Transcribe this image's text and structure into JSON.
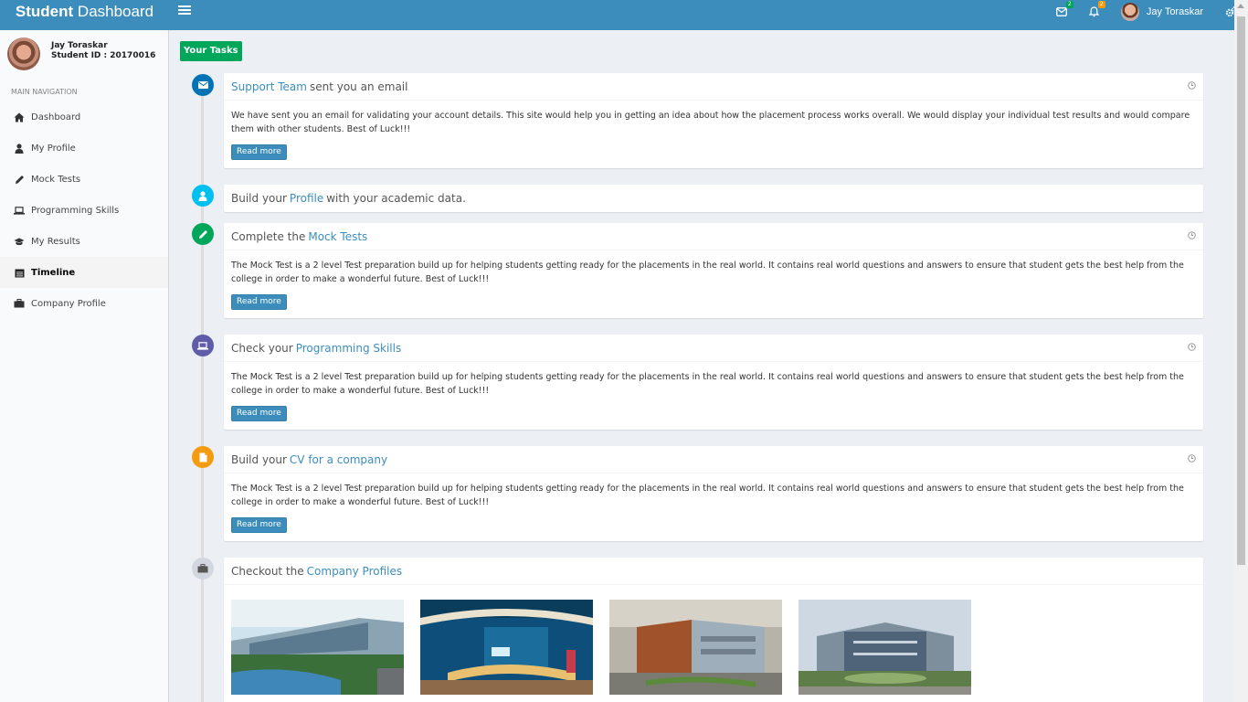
{
  "header": {
    "brand_bold": "Student",
    "brand_rest": " Dashboard",
    "messages_count": "2",
    "notifications_count": "2",
    "user_name": "Jay Toraskar",
    "colors": {
      "primary": "#3c8dbc",
      "badge_green": "#00a65a",
      "badge_yellow": "#f39c12"
    }
  },
  "sidebar": {
    "user_name": "Jay Toraskar",
    "student_id": "Student ID : 20170016",
    "nav_header": "MAIN NAVIGATION",
    "items": [
      {
        "label": "Dashboard",
        "icon": "home-icon"
      },
      {
        "label": "My Profile",
        "icon": "user-icon"
      },
      {
        "label": "Mock Tests",
        "icon": "pencil-icon"
      },
      {
        "label": "Programming Skills",
        "icon": "laptop-icon"
      },
      {
        "label": "My Results",
        "icon": "graduation-cap-icon"
      },
      {
        "label": "Timeline",
        "icon": "calendar-icon",
        "active": true
      },
      {
        "label": "Company Profile",
        "icon": "briefcase-icon"
      }
    ]
  },
  "timeline": {
    "label": "Your Tasks",
    "items": [
      {
        "icon": "envelope-icon",
        "icon_color": "#0073b7",
        "link": "Support Team",
        "after": "sent you an email",
        "body": "We have sent you an email for validating your account details. This site would help you in getting an idea about how the placement process works overall. We would display your individual test results and would compare them with other students. Best of Luck!!!",
        "button": "Read more"
      },
      {
        "icon": "user-icon",
        "icon_color": "#00c0ef",
        "before": "Build your",
        "link": "Profile",
        "after": "with your academic data."
      },
      {
        "icon": "pencil-icon",
        "icon_color": "#00a65a",
        "before": "Complete the",
        "link": "Mock Tests",
        "body": "The Mock Test is a 2 level Test preparation build up for helping students getting ready for the placements in the real world. It contains real world questions and answers to ensure that student gets the best help from the college in order to make a wonderful future. Best of Luck!!!",
        "button": "Read more"
      },
      {
        "icon": "laptop-icon",
        "icon_color": "#605ca8",
        "before": "Check your",
        "link": "Programming Skills",
        "body": "The Mock Test is a 2 level Test preparation build up for helping students getting ready for the placements in the real world. It contains real world questions and answers to ensure that student gets the best help from the college in order to make a wonderful future. Best of Luck!!!",
        "button": "Read more"
      },
      {
        "icon": "file-icon",
        "icon_color": "#f39c12",
        "before": "Build your",
        "link": "CV for a company",
        "body": "The Mock Test is a 2 level Test preparation build up for helping students getting ready for the placements in the real world. It contains real world questions and answers to ensure that student gets the best help from the college in order to make a wonderful future. Best of Luck!!!",
        "button": "Read more"
      },
      {
        "icon": "briefcase-icon",
        "icon_color": "#d2d6de",
        "before": "Checkout the",
        "link": "Company Profiles"
      }
    ]
  }
}
